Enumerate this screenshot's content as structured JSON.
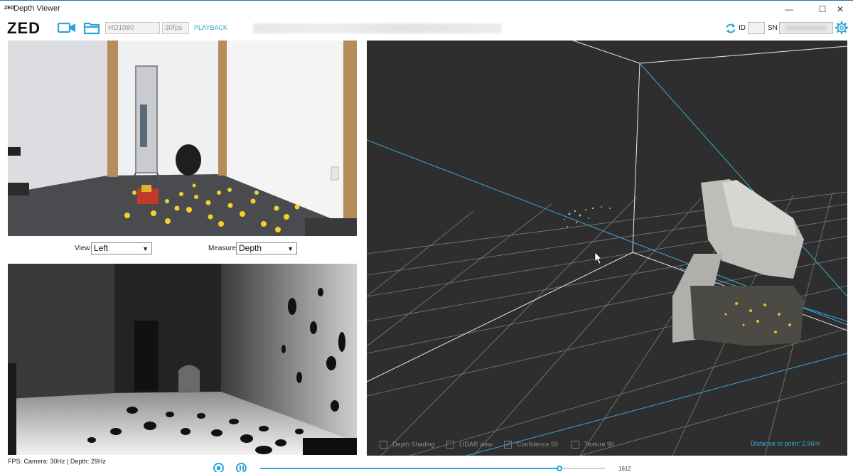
{
  "window": {
    "app_icon_text": "ZED",
    "title": "Depth Viewer",
    "minimize_label": "—",
    "maximize_label": "☐",
    "close_label": "✕"
  },
  "toolbar": {
    "logo": "ZED",
    "resolution": "HD1080",
    "fps": "30fps",
    "playback_label": "PLAYBACK",
    "id_label": "ID",
    "id_value": "",
    "sn_label": "SN"
  },
  "controls": {
    "view_label": "View",
    "view_value": "Left",
    "measure_label": "Measure",
    "measure_value": "Depth"
  },
  "viewer": {
    "options": [
      {
        "label": "Depth Shading",
        "checked": false
      },
      {
        "label": "LIDAR view",
        "checked": false
      },
      {
        "label": "Confidence 50",
        "checked": true
      },
      {
        "label": "Texture 90",
        "checked": false
      }
    ],
    "distance_text": "Distance to point: 2.96m"
  },
  "status": {
    "fps_text": "FPS: Camera: 30Hz | Depth: 29Hz",
    "frame": "1612",
    "progress": 0.87
  },
  "colors": {
    "accent": "#2aa3d8",
    "viewer_bg": "#2e2e2e",
    "grid": "#9a9a9a",
    "frustum": "#3aa7db"
  },
  "icons": [
    "camera-icon",
    "folder-icon",
    "refresh-icon",
    "gear-icon",
    "stop-icon",
    "pause-icon",
    "mouse-cursor-icon"
  ]
}
